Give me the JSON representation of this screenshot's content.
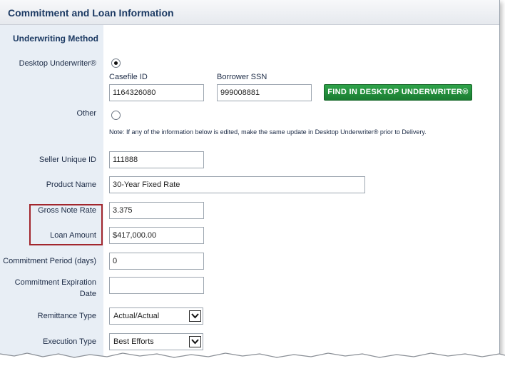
{
  "header": {
    "title": "Commitment and Loan Information"
  },
  "section": {
    "title": "Underwriting Method"
  },
  "desktop_underwriter": {
    "label": "Desktop Underwriter®",
    "selected": true,
    "casefile_label": "Casefile ID",
    "casefile_value": "1164326080",
    "ssn_label": "Borrower SSN",
    "ssn_value": "999008881",
    "find_button": "FIND IN DESKTOP UNDERWRITER®"
  },
  "other": {
    "label": "Other",
    "selected": false,
    "note": "Note: If any of the information below is edited, make the same update in Desktop Underwriter® prior to Delivery."
  },
  "fields": {
    "seller_unique_id": {
      "label": "Seller Unique ID",
      "value": "111888"
    },
    "product_name": {
      "label": "Product Name",
      "value": "30-Year Fixed Rate"
    },
    "gross_note_rate": {
      "label": "Gross Note Rate",
      "value": "3.375"
    },
    "loan_amount": {
      "label": "Loan Amount",
      "value": "$417,000.00"
    },
    "commitment_period": {
      "label": "Commitment Period (days)",
      "value": "0"
    },
    "commitment_expiration": {
      "label_line1": "Commitment Expiration",
      "label_line2": "Date",
      "value": ""
    },
    "remittance_type": {
      "label": "Remittance Type",
      "value": "Actual/Actual"
    },
    "execution_type": {
      "label": "Execution Type",
      "value": "Best Efforts"
    }
  },
  "colors": {
    "accent_green": "#1f8a38",
    "highlight_red": "#a2262d",
    "header_text": "#1c3a63"
  }
}
